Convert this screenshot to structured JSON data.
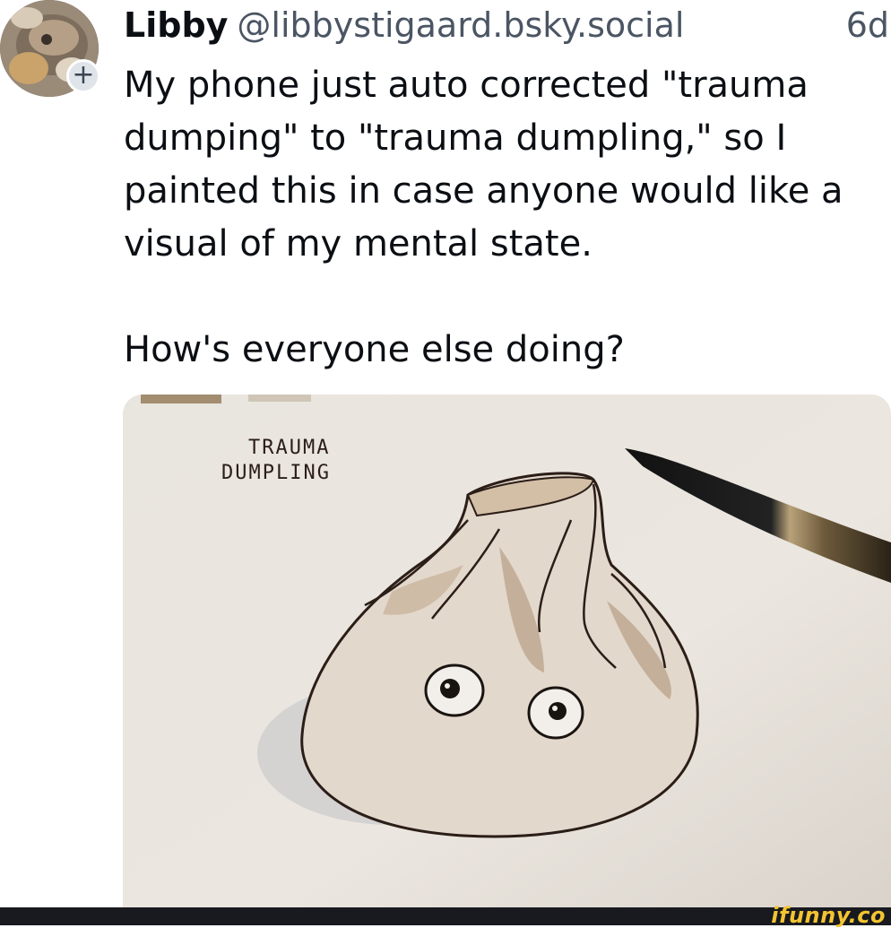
{
  "post": {
    "author": {
      "display_name": "Libby",
      "handle": "@libbystigaard.bsky.social",
      "avatar_icon": "user-avatar",
      "follow_symbol": "+"
    },
    "timestamp": "6d",
    "text": "My phone just auto corrected \"trauma dumping\" to \"trauma dumpling,\" so I painted this in case anyone would like a visual of my mental state.\n\nHow's everyone else doing?",
    "image": {
      "caption_line1": "TRAUMA",
      "caption_line2": "DUMPLING"
    }
  },
  "watermark": "ifunny.co",
  "colors": {
    "text": "#0b0f14",
    "secondary_text": "#4b5563",
    "paper": "#ece7e0",
    "ink": "#2b1d17",
    "watermark": "#f4c430",
    "footer": "#181a1f"
  }
}
